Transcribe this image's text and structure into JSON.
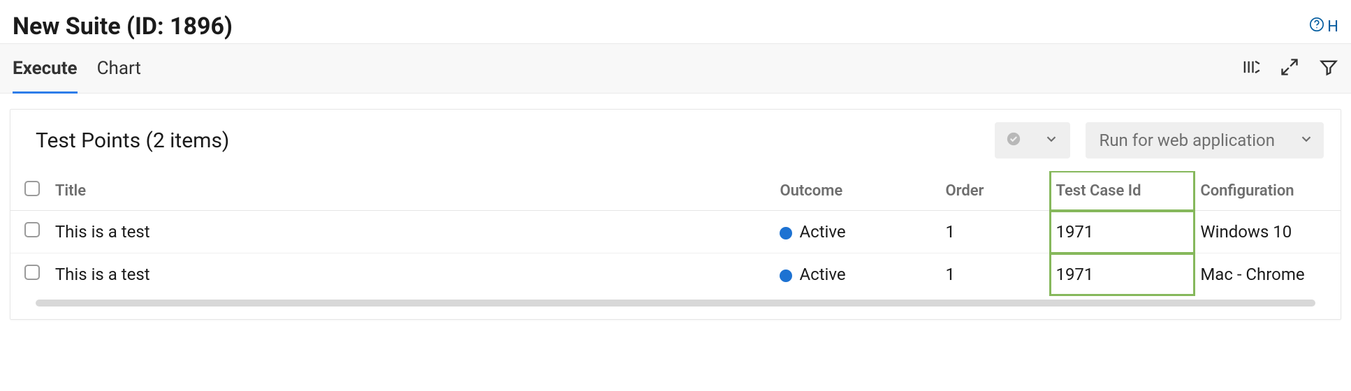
{
  "header": {
    "title": "New Suite (ID: 1896)",
    "help_label": "H"
  },
  "tabs": {
    "execute": "Execute",
    "chart": "Chart"
  },
  "panel": {
    "title": "Test Points (2 items)",
    "run_button": "Run for web application"
  },
  "columns": {
    "title": "Title",
    "outcome": "Outcome",
    "order": "Order",
    "tcid": "Test Case Id",
    "config": "Configuration"
  },
  "rows": [
    {
      "title": "This is a test",
      "outcome": "Active",
      "order": "1",
      "tcid": "1971",
      "config": "Windows 10"
    },
    {
      "title": "This is a test",
      "outcome": "Active",
      "order": "1",
      "tcid": "1971",
      "config": "Mac - Chrome"
    }
  ]
}
